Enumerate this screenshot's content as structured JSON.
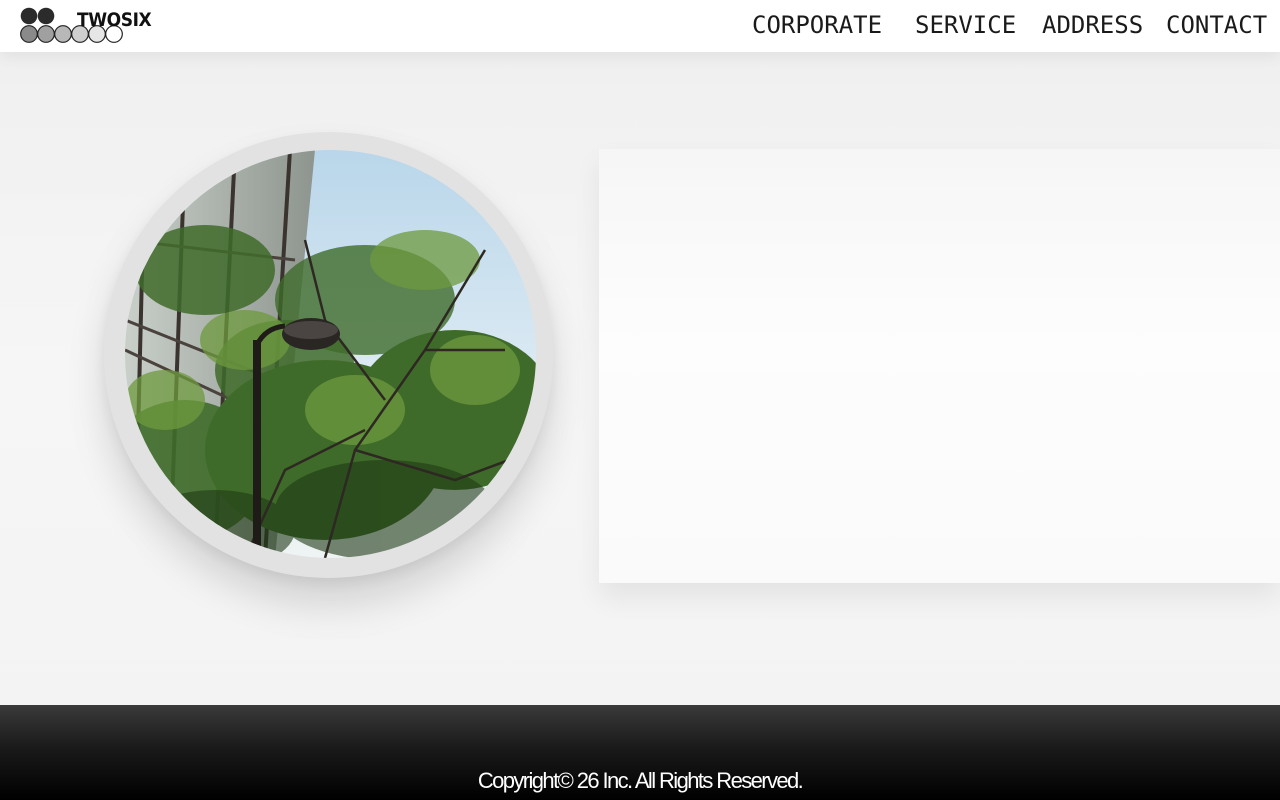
{
  "brand": {
    "name": "TWOSIX",
    "logo_icon": "logo-circles-icon"
  },
  "nav": {
    "items": [
      {
        "label": "CORPORATE"
      },
      {
        "label": "SERVICE"
      },
      {
        "label": "ADDRESS"
      },
      {
        "label": "CONTACT"
      }
    ]
  },
  "hero": {
    "photo": "building-trees-photo"
  },
  "footer": {
    "copyright": "Copyright© 26 Inc. All Rights Reserved."
  },
  "colors": {
    "background": "#f2f2f2",
    "footer_bg": "#000000",
    "nav_text": "#1a1a1a"
  }
}
